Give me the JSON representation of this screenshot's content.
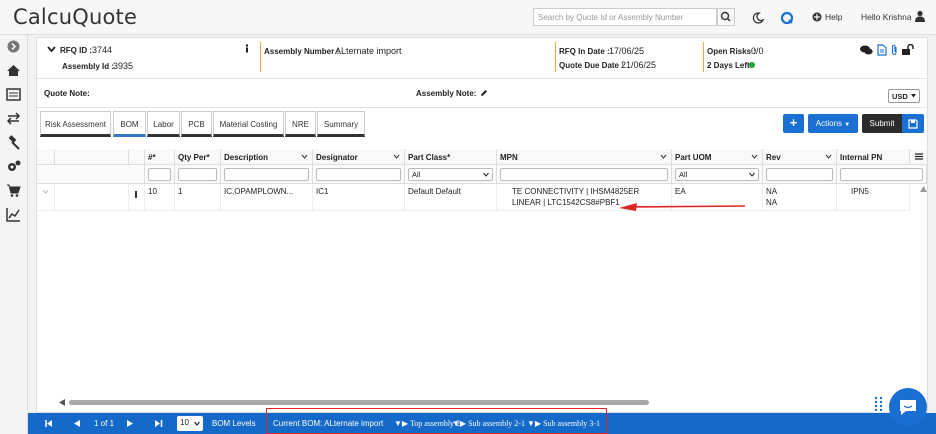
{
  "app": {
    "logo": "CalcuQuote",
    "search_placeholder": "Search by Quote Id or Assembly Number",
    "help": "Help",
    "user": "Hello Krishna"
  },
  "header": {
    "rfq_label": "RFQ ID :",
    "rfq_id": "3744",
    "assembly_id_label": "Assembly Id :",
    "assembly_id": "3935",
    "assembly_number_label": "Assembly Number :",
    "assembly_number": "ALternate import",
    "rfq_in_date_label": "RFQ In Date :",
    "rfq_in_date": "17/06/25",
    "quote_due_label": "Quote Due Date :",
    "quote_due_date": "21/06/25",
    "open_risks_label": "Open Risks :",
    "open_risks": "0/0",
    "days_left": "2 Days Left",
    "status_color": "#1fa33a"
  },
  "notes": {
    "quote_note_label": "Quote Note:",
    "assembly_note_label": "Assembly Note:",
    "currency": "USD"
  },
  "tabs": [
    "Risk Assessment",
    "BOM",
    "Labor",
    "PCB",
    "Material Costing",
    "NRE",
    "Summary"
  ],
  "active_tab": "BOM",
  "toolbar": {
    "add_label": "+",
    "actions_label": "Actions",
    "submit_label": "Submit"
  },
  "grid": {
    "columns": [
      "#*",
      "Qty Per*",
      "Description",
      "Designator",
      "Part Class*",
      "MPN",
      "Part UOM",
      "Rev",
      "Internal PN"
    ],
    "filters": {
      "part_class": "All",
      "part_uom": "All"
    },
    "rows": [
      {
        "num": "10",
        "qty": "1",
        "description": "IC,OPAMPLOWN...",
        "designator": "IC1",
        "part_class": "Default Default",
        "mpn_1": "TE CONNECTIVITY | IHSM4825ER",
        "mpn_2": "LINEAR | LTC1542CS8#PBF1",
        "uom": "EA",
        "rev_1": "NA",
        "rev_2": "NA",
        "internal_pn": "IPN5"
      }
    ]
  },
  "footer": {
    "page_info": "1 of 1",
    "page_size": "10",
    "bom_levels": "BOM Levels",
    "current_bom": "Current BOM: ALternate import",
    "crumbs": [
      "Top assembly 2",
      "Sub assembly 2-1",
      "Sub assembly 3-1"
    ]
  },
  "colors": {
    "primary": "#1a6fd3",
    "footer": "#1469c9",
    "annotation": "#e02424",
    "accent_line": "#f0a94a"
  }
}
